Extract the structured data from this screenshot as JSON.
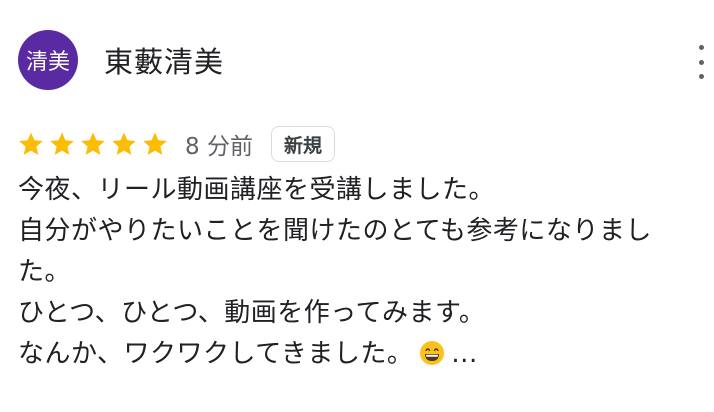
{
  "reviewer": {
    "avatar_text": "清美",
    "avatar_color": "#5a2aa3",
    "name": "東藪清美"
  },
  "rating": {
    "stars": 5,
    "max_stars": 5,
    "star_color": "#fbbc04"
  },
  "time_ago": "8 分前",
  "badge_label": "新規",
  "review": {
    "lines": [
      "今夜、リール動画講座を受講しました。",
      "自分がやりたいことを聞けたのとても参考になりまし",
      "た。",
      "ひとつ、ひとつ、動画を作ってみます。",
      "なんか、ワクワクしてきました。"
    ],
    "trailing_emoji": "grinning-face-emoji",
    "truncation": "..."
  },
  "menu_icon": "more-vertical-icon"
}
